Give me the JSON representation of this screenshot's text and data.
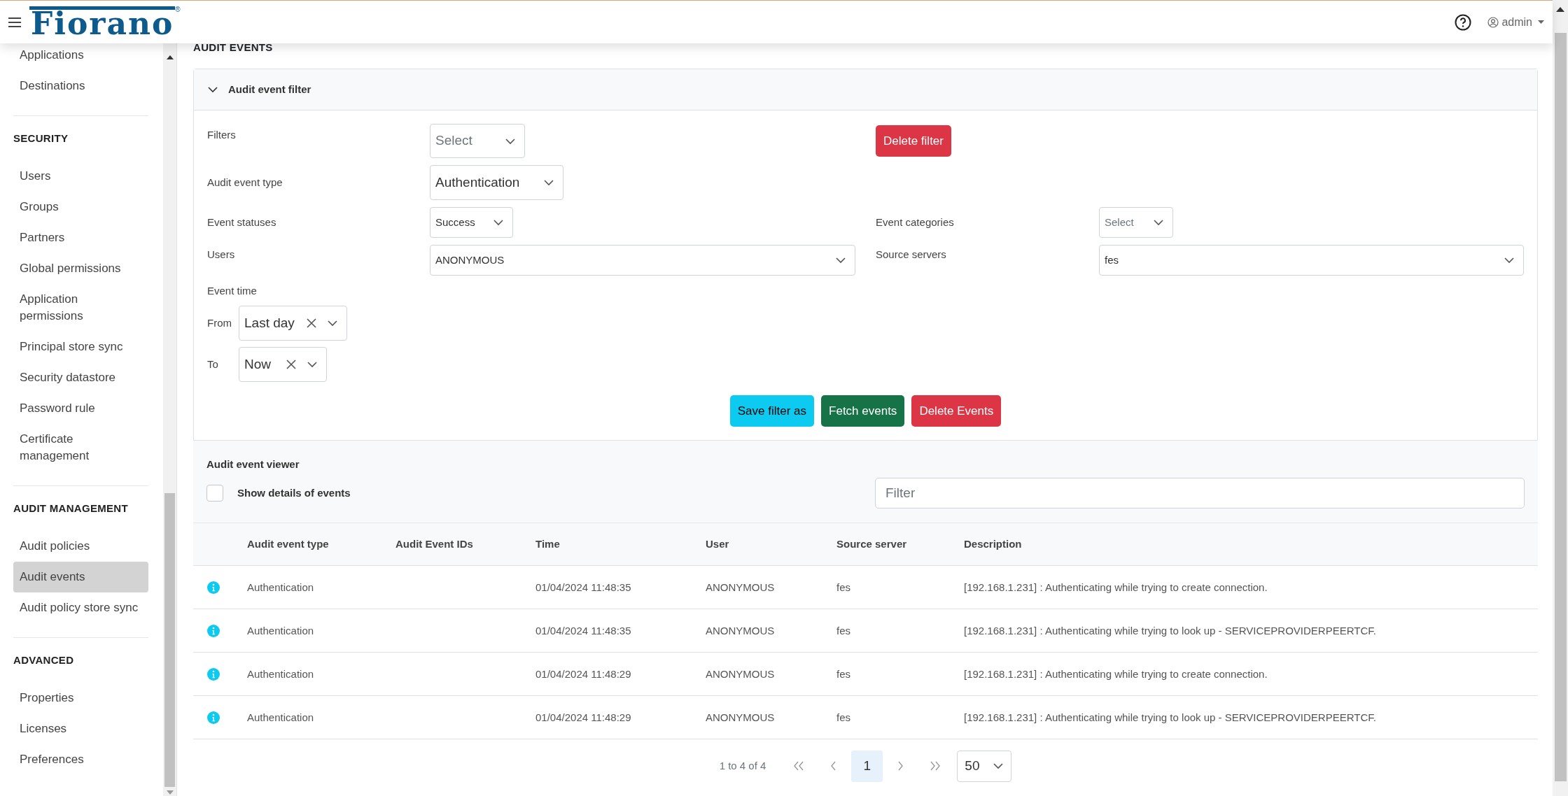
{
  "header": {
    "logo": "Fiorano",
    "logo_mark": "®",
    "user": "admin"
  },
  "sidebar": {
    "sections": [
      {
        "items": [
          {
            "label": "Applications",
            "selected": false
          },
          {
            "label": "Destinations",
            "selected": false
          }
        ]
      },
      {
        "title": "SECURITY",
        "items": [
          {
            "label": "Users",
            "selected": false
          },
          {
            "label": "Groups",
            "selected": false
          },
          {
            "label": "Partners",
            "selected": false
          },
          {
            "label": "Global permissions",
            "selected": false
          },
          {
            "label": "Application permissions",
            "selected": false
          },
          {
            "label": "Principal store sync",
            "selected": false
          },
          {
            "label": "Security datastore",
            "selected": false
          },
          {
            "label": "Password rule",
            "selected": false
          },
          {
            "label": "Certificate management",
            "selected": false
          }
        ]
      },
      {
        "title": "AUDIT MANAGEMENT",
        "items": [
          {
            "label": "Audit policies",
            "selected": false
          },
          {
            "label": "Audit events",
            "selected": true
          },
          {
            "label": "Audit policy store sync",
            "selected": false
          }
        ]
      },
      {
        "title": "ADVANCED",
        "items": [
          {
            "label": "Properties",
            "selected": false
          },
          {
            "label": "Licenses",
            "selected": false
          },
          {
            "label": "Preferences",
            "selected": false
          }
        ]
      }
    ]
  },
  "page_title": "AUDIT EVENTS",
  "filter_panel": {
    "title": "Audit event filter",
    "expanded": true,
    "filters": {
      "label": "Filters",
      "placeholder": "Select"
    },
    "delete_filter": {
      "label": "Delete filter",
      "kind": "danger"
    },
    "audit_event_type": {
      "label": "Audit event type",
      "value": "Authentication"
    },
    "event_statuses": {
      "label": "Event statuses",
      "value": "Success"
    },
    "event_categories": {
      "label": "Event categories",
      "placeholder": "Select"
    },
    "users": {
      "label": "Users",
      "value": "ANONYMOUS"
    },
    "source_servers": {
      "label": "Source servers",
      "value": "fes"
    },
    "event_time": {
      "label": "Event time",
      "from": {
        "label": "From",
        "value": "Last day"
      },
      "to": {
        "label": "To",
        "value": "Now"
      }
    },
    "actions": [
      {
        "label": "Save filter as",
        "kind": "info"
      },
      {
        "label": "Fetch events",
        "kind": "success"
      },
      {
        "label": "Delete Events",
        "kind": "danger"
      }
    ]
  },
  "viewer": {
    "title": "Audit event viewer",
    "show_details": {
      "label": "Show details of events",
      "checked": false
    },
    "filter": {
      "placeholder": "Filter"
    }
  },
  "table": {
    "columns": [
      "Audit event type",
      "Audit Event IDs",
      "Time",
      "User",
      "Source server",
      "Description"
    ],
    "rows": [
      {
        "cells": [
          "Authentication",
          "",
          "01/04/2024 11:48:35",
          "ANONYMOUS",
          "fes",
          "[192.168.1.231] : Authenticating while trying to create connection."
        ]
      },
      {
        "cells": [
          "Authentication",
          "",
          "01/04/2024 11:48:35",
          "ANONYMOUS",
          "fes",
          "[192.168.1.231] : Authenticating while trying to look up - SERVICEPROVIDERPEERTCF."
        ]
      },
      {
        "cells": [
          "Authentication",
          "",
          "01/04/2024 11:48:29",
          "ANONYMOUS",
          "fes",
          "[192.168.1.231] : Authenticating while trying to create connection."
        ]
      },
      {
        "cells": [
          "Authentication",
          "",
          "01/04/2024 11:48:29",
          "ANONYMOUS",
          "fes",
          "[192.168.1.231] : Authenticating while trying to look up - SERVICEPROVIDERPEERTCF."
        ]
      }
    ]
  },
  "pagination": {
    "summary": "1 to 4 of 4",
    "pages": [
      {
        "label": "1",
        "selected": true
      }
    ],
    "page_size": "50"
  }
}
